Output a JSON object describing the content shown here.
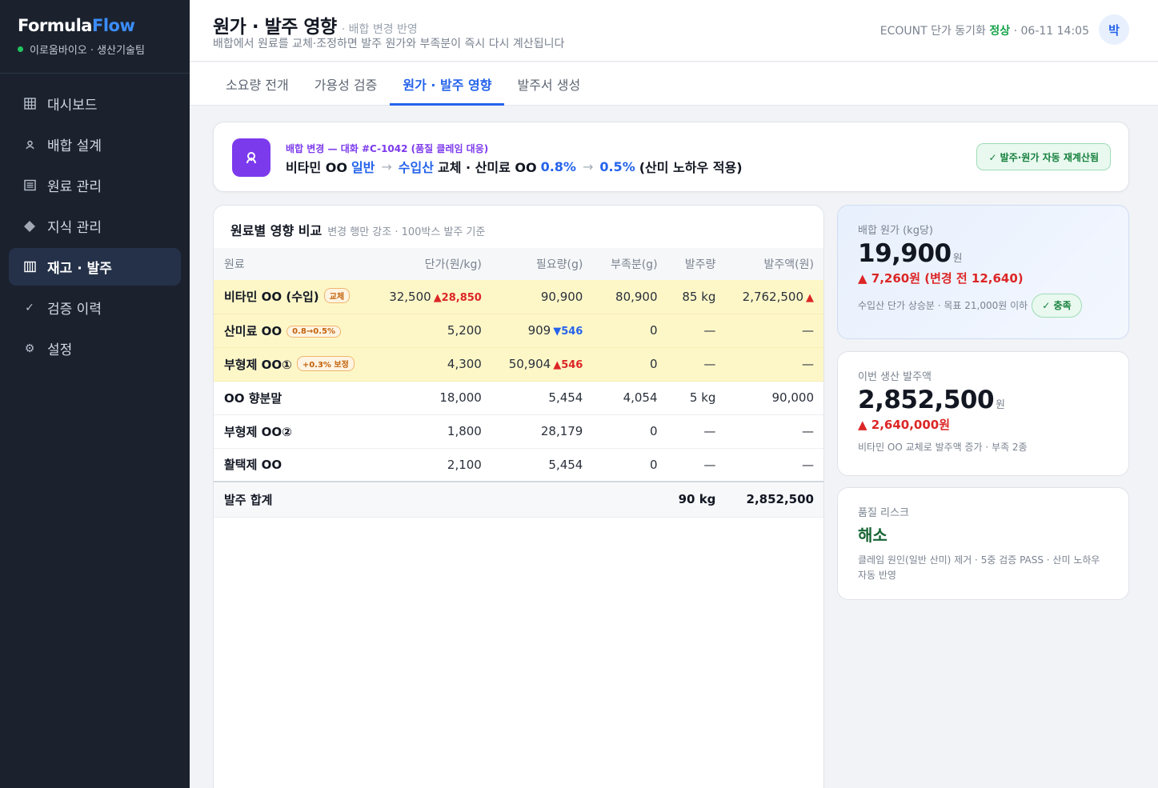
{
  "sidebar": {
    "brand_main": "Formula",
    "brand_accent": "Flow",
    "org": "이로움바이오 · 생산기술팀",
    "items": [
      {
        "label": "대시보드",
        "icon": "dashboard-icon"
      },
      {
        "label": "배합 설계",
        "icon": "flask-icon"
      },
      {
        "label": "원료 관리",
        "icon": "list-icon"
      },
      {
        "label": "지식 관리",
        "icon": "diamond-icon"
      },
      {
        "label": "재고 · 발주",
        "icon": "inventory-icon",
        "active": true
      },
      {
        "label": "검증 이력",
        "icon": "check-icon"
      },
      {
        "label": "설정",
        "icon": "gear-icon"
      }
    ]
  },
  "header": {
    "title": "원가 · 발주 영향",
    "subtitle": "· 배합 변경 반영",
    "description": "배합에서 원료를 교체·조정하면 발주 원가와 부족분이 즉시 다시 계산됩니다",
    "sync_prefix": "ECOUNT 단가 동기화",
    "sync_status": "정상",
    "sync_time": "· 06-11 14:05",
    "avatar": "박"
  },
  "tabs": [
    {
      "label": "소요량 전개"
    },
    {
      "label": "가용성 검증"
    },
    {
      "label": "원가 · 발주 영향",
      "active": true
    },
    {
      "label": "발주서 생성"
    }
  ],
  "banner": {
    "tag": "배합 변경 — 대화 #C-1042 (품질 클레임 대응)",
    "part1": "비타민 OO",
    "part2": "일반",
    "part3": "수입산",
    "part4": "교체 · 산미료 OO",
    "part5": "0.8%",
    "part6": "0.5%",
    "part7": "(산미 노하우 적용)",
    "recalc": "✓ 발주·원가 자동 재계산됨"
  },
  "table": {
    "title": "원료별 영향 비교",
    "subtitle": "변경 행만 강조 · 100박스 발주 기준",
    "headers": [
      "원료",
      "단가(원/kg)",
      "필요량(g)",
      "부족분(g)",
      "발주량",
      "발주액(원)"
    ],
    "rows": [
      {
        "name": "비타민 OO (수입)",
        "badge": "교체",
        "price": "32,500",
        "price_delta": "▲28,850",
        "need": "90,900",
        "need_delta": "",
        "short": "80,900",
        "order": "85 kg",
        "amount": "2,762,500",
        "amount_delta": "▲"
      },
      {
        "name": "산미료 OO",
        "badge": "0.8→0.5%",
        "price": "5,200",
        "price_delta": "",
        "need": "909",
        "need_delta": "▼546",
        "short": "0",
        "order": "—",
        "amount": "—",
        "amount_delta": ""
      },
      {
        "name": "부형제 OO①",
        "badge": "+0.3% 보정",
        "price": "4,300",
        "price_delta": "",
        "need": "50,904",
        "need_delta": "▲546",
        "short": "0",
        "order": "—",
        "amount": "—",
        "amount_delta": ""
      },
      {
        "name": "OO 향분말",
        "badge": "",
        "price": "18,000",
        "price_delta": "",
        "need": "5,454",
        "need_delta": "",
        "short": "4,054",
        "order": "5 kg",
        "amount": "90,000",
        "amount_delta": ""
      },
      {
        "name": "부형제 OO②",
        "badge": "",
        "price": "1,800",
        "price_delta": "",
        "need": "28,179",
        "need_delta": "",
        "short": "0",
        "order": "—",
        "amount": "—",
        "amount_delta": ""
      },
      {
        "name": "활택제 OO",
        "badge": "",
        "price": "2,100",
        "price_delta": "",
        "need": "5,454",
        "need_delta": "",
        "short": "0",
        "order": "—",
        "amount": "—",
        "amount_delta": ""
      }
    ],
    "total": {
      "label": "발주 합계",
      "order": "90 kg",
      "amount": "2,852,500"
    }
  },
  "cards": {
    "cost": {
      "label": "배합 원가 (kg당)",
      "value": "19,900",
      "unit": "원",
      "delta": "▲ 7,260원 (변경 전 12,640)",
      "note": "수입산 단가 상승분 · 목표 21,000원 이하",
      "pill": "✓ 충족"
    },
    "order": {
      "label": "이번 생산 발주액",
      "value": "2,852,500",
      "unit": "원",
      "delta": "▲ 2,640,000원",
      "note": "비타민 OO 교체로 발주액 증가 · 부족 2종"
    },
    "risk": {
      "label": "품질 리스크",
      "value": "해소",
      "note": "클레임 원인(일반 산미) 제거 · 5중 검증 PASS · 산미 노하우 자동 반영"
    }
  }
}
